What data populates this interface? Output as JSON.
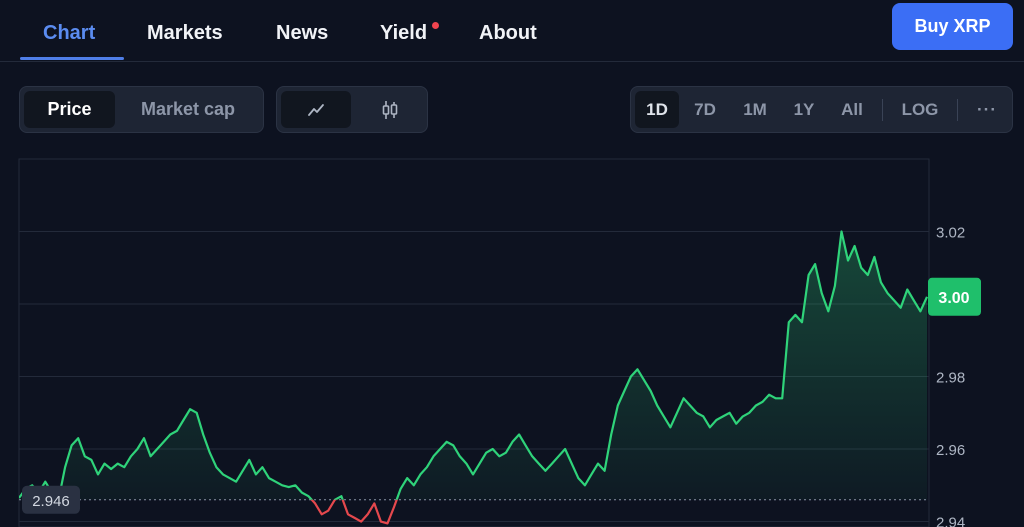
{
  "nav": {
    "tabs": [
      {
        "label": "Chart",
        "active": true
      },
      {
        "label": "Markets",
        "active": false
      },
      {
        "label": "News",
        "active": false
      },
      {
        "label": "Yield",
        "active": false,
        "notification": true
      },
      {
        "label": "About",
        "active": false
      }
    ],
    "buy_button": "Buy XRP"
  },
  "toolbar": {
    "metric": [
      {
        "label": "Price",
        "active": true
      },
      {
        "label": "Market cap",
        "active": false
      }
    ],
    "chart_type": [
      {
        "icon": "line-chart-icon",
        "active": true
      },
      {
        "icon": "candlestick-icon",
        "active": false
      }
    ],
    "ranges": [
      {
        "label": "1D",
        "active": true
      },
      {
        "label": "7D",
        "active": false
      },
      {
        "label": "1M",
        "active": false
      },
      {
        "label": "1Y",
        "active": false
      },
      {
        "label": "All",
        "active": false
      }
    ],
    "log_label": "LOG",
    "more_label": "···"
  },
  "colors": {
    "up": "#2fd37a",
    "down": "#e5484d",
    "accent": "#3b6ef5",
    "current_price_badge": "#1fbf6b"
  },
  "chart_data": {
    "type": "line",
    "ylim": [
      2.9385,
      3.04
    ],
    "y_ticks": [
      2.94,
      2.96,
      2.98,
      3.0,
      3.02
    ],
    "y_tick_labels": [
      "2.94",
      "2.96",
      "2.98",
      "3.00",
      "3.02"
    ],
    "baseline": 2.946,
    "baseline_label": "2.946",
    "current_price_label": "3.00",
    "current_price": 3.002,
    "grid": true,
    "values": [
      2.9465,
      2.949,
      2.95,
      2.948,
      2.951,
      2.948,
      2.946,
      2.955,
      2.961,
      2.963,
      2.958,
      2.957,
      2.953,
      2.956,
      2.9545,
      2.956,
      2.955,
      2.958,
      2.96,
      2.963,
      2.958,
      2.96,
      2.962,
      2.964,
      2.965,
      2.968,
      2.971,
      2.97,
      2.964,
      2.959,
      2.955,
      2.953,
      2.952,
      2.951,
      2.954,
      2.957,
      2.953,
      2.955,
      2.952,
      2.951,
      2.95,
      2.9495,
      2.95,
      2.948,
      2.947,
      2.945,
      2.942,
      2.943,
      2.946,
      2.947,
      2.942,
      2.941,
      2.94,
      2.942,
      2.945,
      2.94,
      2.9395,
      2.944,
      2.949,
      2.952,
      2.95,
      2.953,
      2.955,
      2.958,
      2.96,
      2.962,
      2.961,
      2.958,
      2.956,
      2.953,
      2.956,
      2.959,
      2.96,
      2.958,
      2.959,
      2.962,
      2.964,
      2.961,
      2.958,
      2.956,
      2.954,
      2.956,
      2.958,
      2.96,
      2.956,
      2.952,
      2.95,
      2.953,
      2.956,
      2.954,
      2.964,
      2.972,
      2.976,
      2.98,
      2.982,
      2.979,
      2.976,
      2.972,
      2.969,
      2.966,
      2.97,
      2.974,
      2.972,
      2.97,
      2.969,
      2.966,
      2.968,
      2.969,
      2.97,
      2.967,
      2.969,
      2.97,
      2.972,
      2.973,
      2.975,
      2.974,
      2.974,
      2.995,
      2.997,
      2.995,
      3.008,
      3.011,
      3.003,
      2.998,
      3.005,
      3.02,
      3.012,
      3.016,
      3.01,
      3.008,
      3.013,
      3.006,
      3.003,
      3.001,
      2.999,
      3.004,
      3.001,
      2.998,
      3.002
    ]
  }
}
